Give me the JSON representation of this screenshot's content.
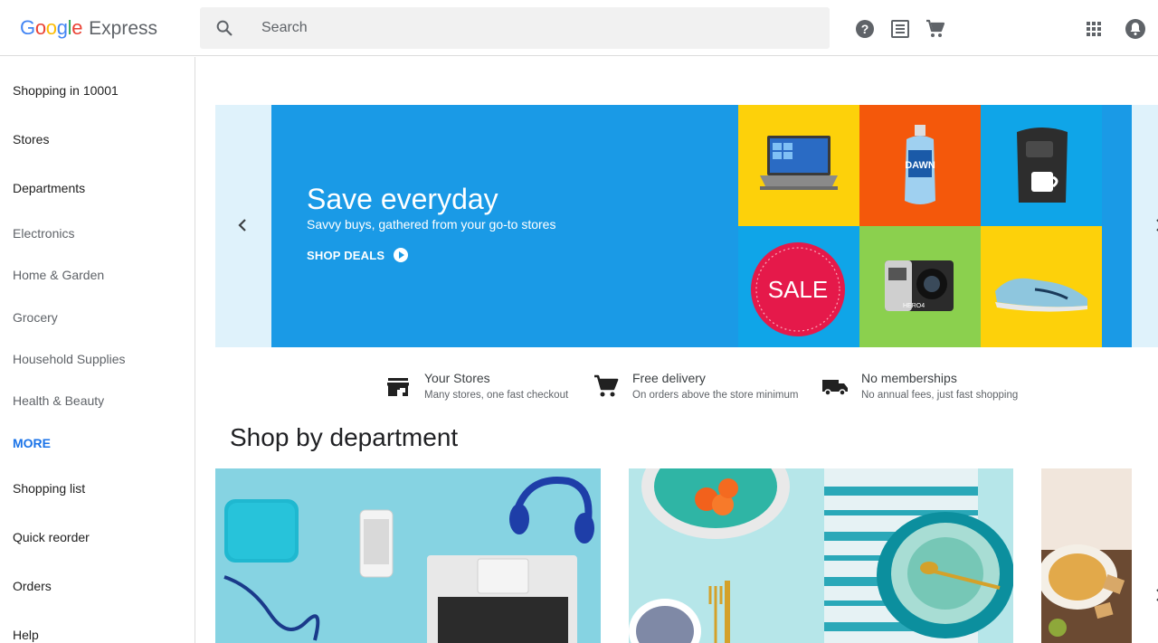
{
  "header": {
    "logo_google": "Google",
    "logo_express": "Express",
    "search_placeholder": "Search",
    "icons": [
      "search-icon",
      "help-icon",
      "orders-list-icon",
      "cart-icon",
      "apps-grid-icon",
      "notifications-icon"
    ]
  },
  "sidebar": {
    "location": "Shopping in 10001",
    "stores": "Stores",
    "departments": "Departments",
    "dept_items": [
      "Electronics",
      "Home & Garden",
      "Grocery",
      "Household Supplies",
      "Health & Beauty"
    ],
    "more": "MORE",
    "shopping_list": "Shopping list",
    "quick_reorder": "Quick reorder",
    "orders": "Orders",
    "help": "Help"
  },
  "banner": {
    "title": "Save everyday",
    "subtitle": "Savvy buys, gathered from your go-to stores",
    "cta": "SHOP DEALS",
    "sale_label": "SALE",
    "camera_label": "HERO4",
    "bottle_label": "DAWN",
    "colors": {
      "banner": "#1a9ae6",
      "yellow": "#fdd10a",
      "orange": "#f4580b",
      "blue": "#0fa5e8",
      "green": "#8bd04e",
      "sale": "#e5194a"
    }
  },
  "features": [
    {
      "title": "Your Stores",
      "subtitle": "Many stores, one fast checkout",
      "icon": "store-icon"
    },
    {
      "title": "Free delivery",
      "subtitle": "On orders above the store minimum",
      "icon": "cart-icon"
    },
    {
      "title": "No memberships",
      "subtitle": "No annual fees, just fast shopping",
      "icon": "truck-icon"
    }
  ],
  "shop_by_department": {
    "title": "Shop by department",
    "cards": [
      "electronics-card",
      "home-garden-card",
      "grocery-card"
    ]
  }
}
